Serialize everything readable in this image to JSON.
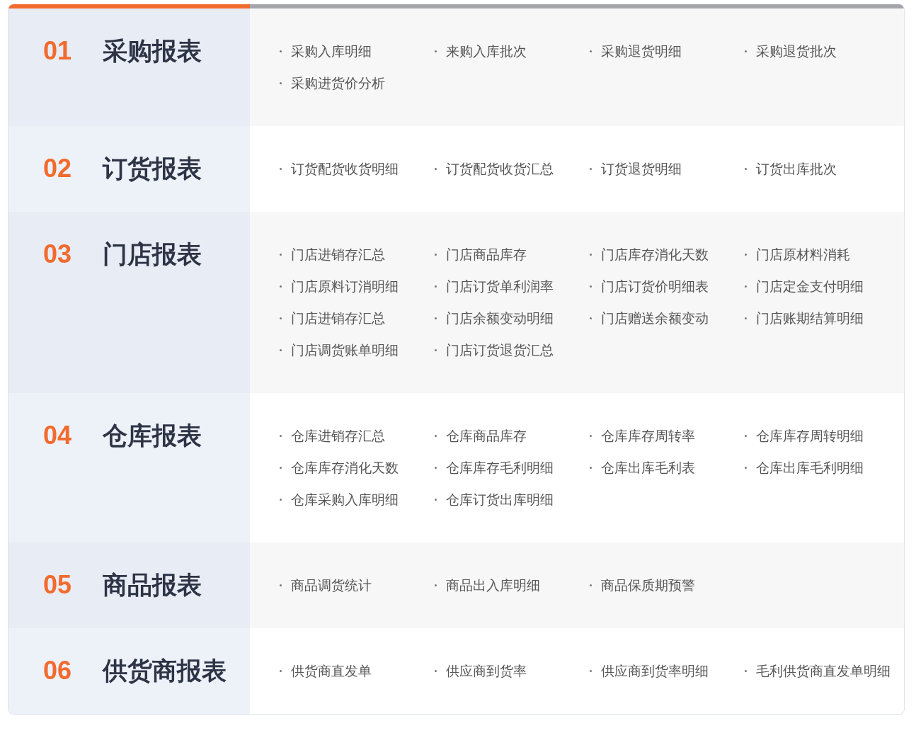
{
  "sections": [
    {
      "number": "01",
      "title": "采购报表",
      "items": [
        "采购入库明细",
        "来购入库批次",
        "采购退货明细",
        "采购退货批次",
        "采购进货价分析"
      ]
    },
    {
      "number": "02",
      "title": "订货报表",
      "items": [
        "订货配货收货明细",
        "订货配货收货汇总",
        "订货退货明细",
        "订货出库批次"
      ]
    },
    {
      "number": "03",
      "title": "门店报表",
      "items": [
        "门店进销存汇总",
        "门店商品库存",
        "门店库存消化天数",
        "门店原材料消耗",
        "门店原料订消明细",
        "门店订货单利润率",
        "门店订货价明细表",
        "门店定金支付明细",
        "门店进销存汇总",
        "门店余额变动明细",
        "门店赠送余额变动",
        "门店账期结算明细",
        "门店调货账单明细",
        "门店订货退货汇总"
      ]
    },
    {
      "number": "04",
      "title": "仓库报表",
      "items": [
        "仓库进销存汇总",
        "仓库商品库存",
        "仓库库存周转率",
        "仓库库存周转明细",
        "仓库库存消化天数",
        "仓库库存毛利明细",
        "仓库出库毛利表",
        "仓库出库毛利明细",
        "仓库采购入库明细",
        "仓库订货出库明细"
      ]
    },
    {
      "number": "05",
      "title": "商品报表",
      "items": [
        "商品调货统计",
        "商品出入库明细",
        "商品保质期预警"
      ]
    },
    {
      "number": "06",
      "title": "供货商报表",
      "items": [
        "供货商直发单",
        "供应商到货率",
        "供应商到货率明细",
        "毛利供货商直发单明细"
      ]
    }
  ]
}
